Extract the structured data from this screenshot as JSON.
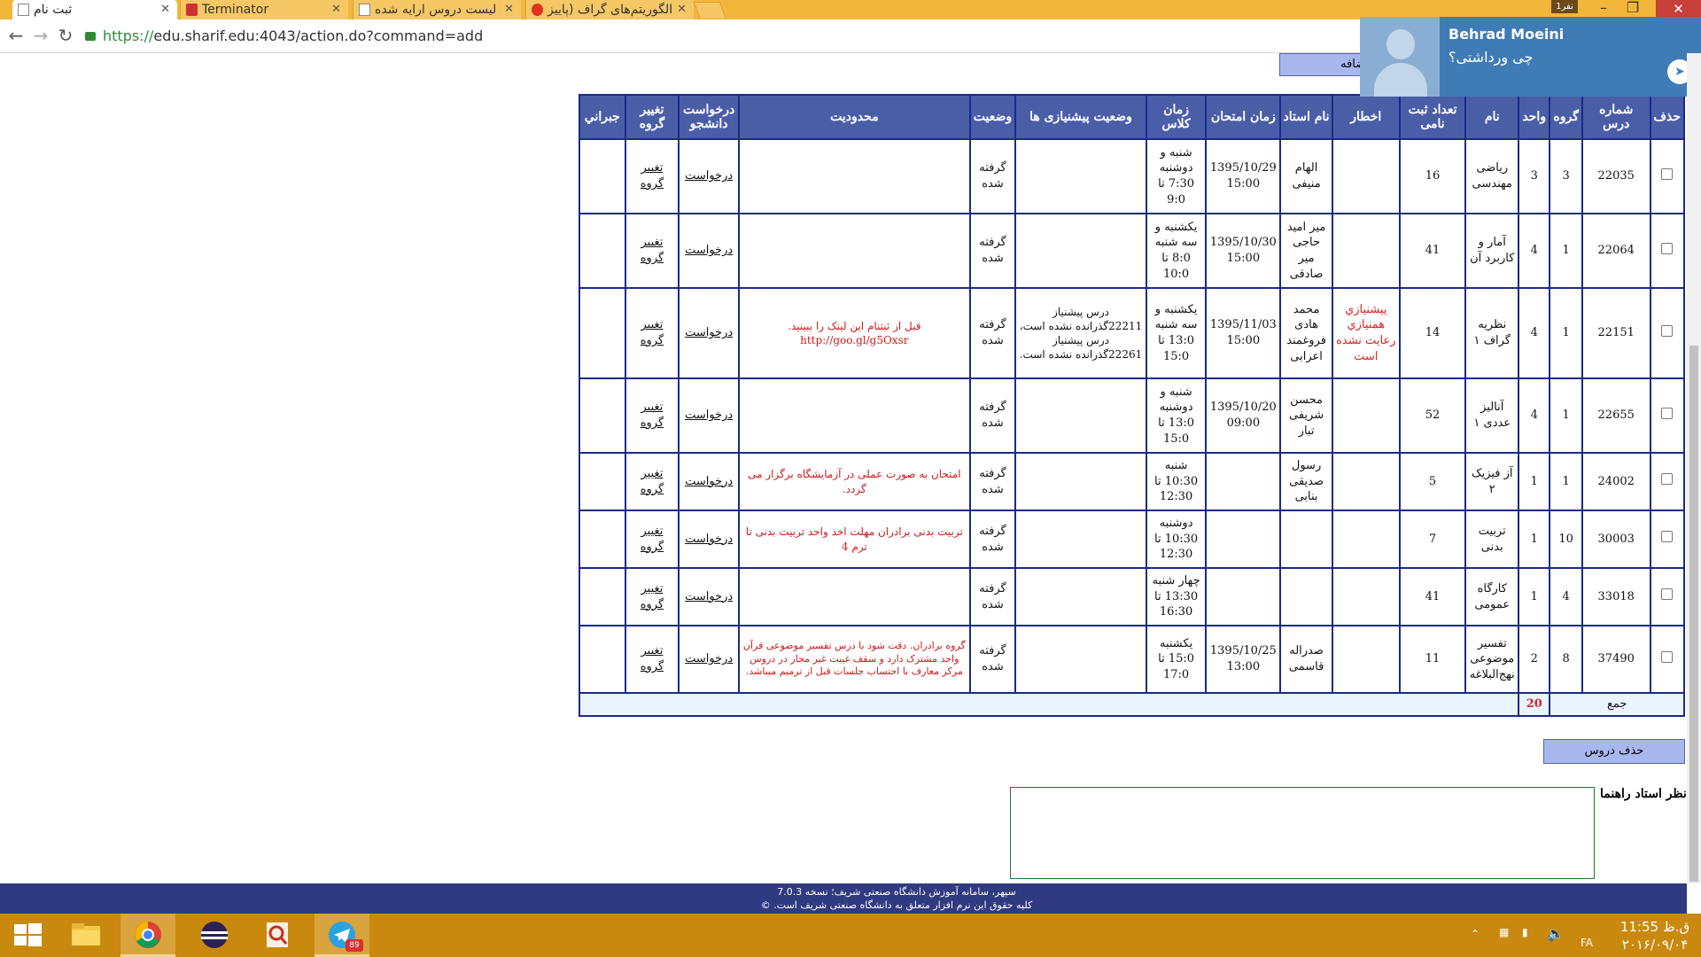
{
  "browser": {
    "tabs": [
      {
        "title": "ثبت نام",
        "active": true
      },
      {
        "title": "Terminator",
        "active": false
      },
      {
        "title": "لیست دروس ارایه شده",
        "active": false
      },
      {
        "title": "الگوریتم‌های گراف (پاییز",
        "active": false
      }
    ],
    "window_badge": "نفر1",
    "url_scheme": "https://",
    "url_rest": "edu.sharif.edu:4043/action.do?command=add"
  },
  "notification": {
    "name": "Behrad Moeini",
    "message": "چی ورداشتی؟"
  },
  "page": {
    "add_button": "اضافه",
    "delete_button": "حذف دروس",
    "advisor_label": "نظر استاد راهنما",
    "advisor_comment": "",
    "footer_line1": "سپهر، سامانه آموزش دانشگاه صنعتی شریف؛ نسخه 7.0.3",
    "footer_line2": "کلیه حقوق این نرم افزار متعلق به دانشگاه صنعتی شریف است. ©"
  },
  "table": {
    "headers": {
      "delete": "حذف",
      "course_no": "شماره درس",
      "group": "گروه",
      "units": "واحد",
      "name": "نام",
      "enrolled": "تعداد ثبت نامی",
      "warning": "اخطار",
      "instructor": "نام استاد",
      "exam_time": "زمان امتحان",
      "class_time": "زمان کلاس",
      "prereq_status": "وضعیت پیشنیازی ها",
      "status": "وضعیت",
      "restriction": "محدودیت",
      "student_request": "درخواست دانشجو",
      "change_group": "تغییر گروه",
      "makeup": "جبراني"
    },
    "rows": [
      {
        "course_no": "22035",
        "group": "3",
        "units": "3",
        "name": "ریاضی مهندسی",
        "enrolled": "16",
        "warning": "",
        "instructor": "الهام منیفی",
        "exam_time": "1395/10/29 15:00",
        "class_time": "شنبه و دوشنبه 7:30 تا 9:0",
        "prereq_status": "",
        "status": "گرفته شده",
        "restriction": "",
        "request": "درخواست",
        "change": "تغییر گروه",
        "makeup": ""
      },
      {
        "course_no": "22064",
        "group": "1",
        "units": "4",
        "name": "آمار و کاربرد آن",
        "enrolled": "41",
        "warning": "",
        "instructor": "میر امید حاجی میر صادقی",
        "exam_time": "1395/10/30 15:00",
        "class_time": "یکشنبه و سه شنبه 8:0 تا 10:0",
        "prereq_status": "",
        "status": "گرفته شده",
        "restriction": "",
        "request": "درخواست",
        "change": "تغییر گروه",
        "makeup": ""
      },
      {
        "course_no": "22151",
        "group": "1",
        "units": "4",
        "name": "نظریه گراف ۱",
        "enrolled": "14",
        "warning": "پیشنیازي همنیازي رعایت نشده است",
        "instructor": "محمد هادی فروغمند اعرابی",
        "exam_time": "1395/11/03 15:00",
        "class_time": "یکشنبه و سه شنبه 13:0 تا 15:0",
        "prereq_status": "درس پیشنیاز 22211گذرانده نشده است، درس پیشنیاز 22261گذرانده نشده است.",
        "status": "گرفته شده",
        "restriction": "قبل از ثبتنام این لینک را ببینید. http://goo.gl/g5Oxsr",
        "request": "درخواست",
        "change": "تغییر گروه",
        "makeup": ""
      },
      {
        "course_no": "22655",
        "group": "1",
        "units": "4",
        "name": "آنالیز عددی ۱",
        "enrolled": "52",
        "warning": "",
        "instructor": "محسن شریفی تبار",
        "exam_time": "1395/10/20 09:00",
        "class_time": "شنبه و دوشنبه 13:0 تا 15:0",
        "prereq_status": "",
        "status": "گرفته شده",
        "restriction": "",
        "request": "درخواست",
        "change": "تغییر گروه",
        "makeup": ""
      },
      {
        "course_no": "24002",
        "group": "1",
        "units": "1",
        "name": "آز فیزیک ۲",
        "enrolled": "5",
        "warning": "",
        "instructor": "رسول صدیقی بنابی",
        "exam_time": "",
        "class_time": "شنبه 10:30 تا 12:30",
        "prereq_status": "",
        "status": "گرفته شده",
        "restriction": "امتحان به صورت عملی در آزمایشگاه برگزار می گردد.",
        "request": "درخواست",
        "change": "تغییر گروه",
        "makeup": ""
      },
      {
        "course_no": "30003",
        "group": "10",
        "units": "1",
        "name": "تربیت بدنی",
        "enrolled": "7",
        "warning": "",
        "instructor": "",
        "exam_time": "",
        "class_time": "دوشنبه 10:30 تا 12:30",
        "prereq_status": "",
        "status": "گرفته شده",
        "restriction": "تربیت بدنی برادران مهلت اخذ واحد تربیت بدنی تا ترم 4",
        "request": "درخواست",
        "change": "تغییر گروه",
        "makeup": ""
      },
      {
        "course_no": "33018",
        "group": "4",
        "units": "1",
        "name": "کارگاه عمومی",
        "enrolled": "41",
        "warning": "",
        "instructor": "",
        "exam_time": "",
        "class_time": "چهار شنبه 13:30 تا 16:30",
        "prereq_status": "",
        "status": "گرفته شده",
        "restriction": "",
        "request": "درخواست",
        "change": "تغییر گروه",
        "makeup": ""
      },
      {
        "course_no": "37490",
        "group": "8",
        "units": "2",
        "name": "تفسیر موضوعی نهج‌البلاغه",
        "enrolled": "11",
        "warning": "",
        "instructor": "صدراله قاسمی",
        "exam_time": "1395/10/25 13:00",
        "class_time": "یکشنبه 15:0 تا 17:0",
        "prereq_status": "",
        "status": "گرفته شده",
        "restriction": "گروه برادران. دقت شود با درس تفسیر موضوعی قرآن واحد مشترک دارد و سقف غیبت غیر مجاز در دروس مرکز معارف با احتساب جلسات قبل از ترمیم میباشد.",
        "request": "درخواست",
        "change": "تغییر گروه",
        "makeup": ""
      }
    ],
    "sum_label": "جمع",
    "sum_units": "20"
  },
  "taskbar": {
    "telegram_badge": "89",
    "lang": "FA",
    "time": "11:55 ق.ظ",
    "ampm": "ق.ظ",
    "date": "۲۰۱۶/۰۹/۰۴"
  }
}
